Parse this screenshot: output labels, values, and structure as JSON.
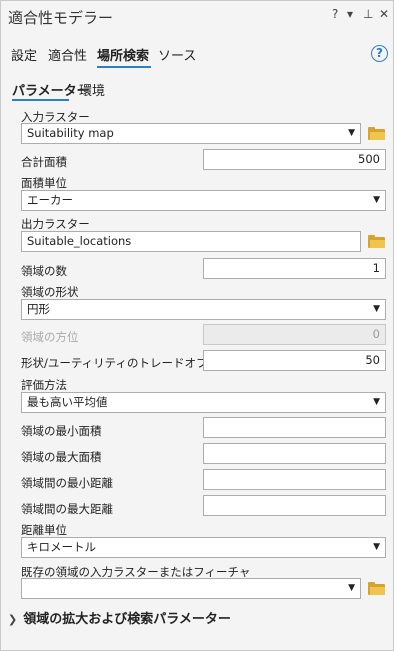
{
  "window": {
    "title": "適合性モデラー",
    "help_glyph": "?",
    "menu_glyph": "▾",
    "pin_glyph": "⊥",
    "close_glyph": "✕"
  },
  "main_tabs": [
    {
      "label": "設定",
      "active": false
    },
    {
      "label": "適合性",
      "active": false
    },
    {
      "label": "場所検索",
      "active": true
    },
    {
      "label": "ソース",
      "active": false
    }
  ],
  "help_button": {
    "glyph": "?"
  },
  "sub_tabs": [
    {
      "label": "パラメーター",
      "active": true
    },
    {
      "label": "環境",
      "active": false
    }
  ],
  "params": {
    "input_raster": {
      "label": "入力ラスター",
      "value": "Suitability map"
    },
    "total_area": {
      "label": "合計面積",
      "value": "500"
    },
    "area_unit": {
      "label": "面積単位",
      "value": "エーカー"
    },
    "output_raster": {
      "label": "出力ラスター",
      "value": "Suitable_locations"
    },
    "region_count": {
      "label": "領域の数",
      "value": "1"
    },
    "region_shape": {
      "label": "領域の形状",
      "value": "円形"
    },
    "region_orientation": {
      "label": "領域の方位",
      "value": "0"
    },
    "shape_tradeoff": {
      "label": "形状/ユーティリティのトレードオフ (%)",
      "value": "50"
    },
    "evaluation_method": {
      "label": "評価方法",
      "value": "最も高い平均値"
    },
    "min_area": {
      "label": "領域の最小面積",
      "value": ""
    },
    "max_area": {
      "label": "領域の最大面積",
      "value": ""
    },
    "min_distance": {
      "label": "領域間の最小距離",
      "value": ""
    },
    "max_distance": {
      "label": "領域間の最大距離",
      "value": ""
    },
    "distance_unit": {
      "label": "距離単位",
      "value": "キロメートル"
    },
    "existing_regions": {
      "label": "既存の領域の入力ラスターまたはフィーチャ",
      "value": ""
    }
  },
  "expander": {
    "label": "領域の拡大および検索パラメーター"
  },
  "colors": {
    "accent": "#2d7fc1",
    "folder": "#f0c54e"
  }
}
